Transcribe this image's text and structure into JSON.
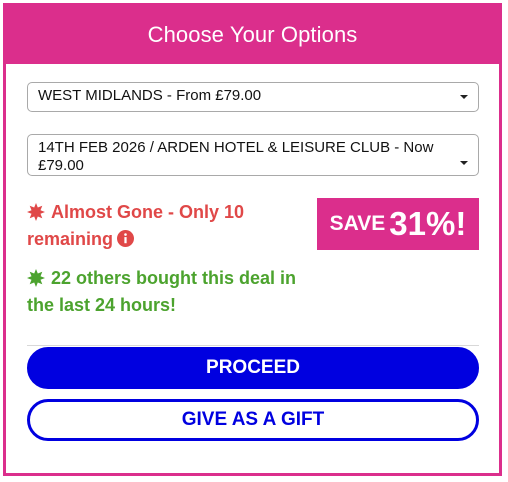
{
  "header": {
    "title": "Choose Your Options"
  },
  "options": {
    "region": {
      "selected": "WEST MIDLANDS - From £79.00"
    },
    "date_hotel": {
      "selected": "14TH FEB 2026 / ARDEN HOTEL & LEISURE CLUB - Now £79.00"
    }
  },
  "status": {
    "scarcity": {
      "text": "Almost Gone - Only 10 remaining",
      "color": "#e04848",
      "icon": "burst-icon"
    },
    "social_proof": {
      "text": "22 others bought this deal in the last 24 hours!",
      "color": "#4ca32e",
      "icon": "burst-icon"
    }
  },
  "badge": {
    "save_label": "SAVE",
    "save_percent": "31%!"
  },
  "actions": {
    "proceed_label": "PROCEED",
    "gift_label": "GIVE AS A GIFT"
  },
  "colors": {
    "brand": "#db2e8c",
    "action": "#0000e0"
  }
}
